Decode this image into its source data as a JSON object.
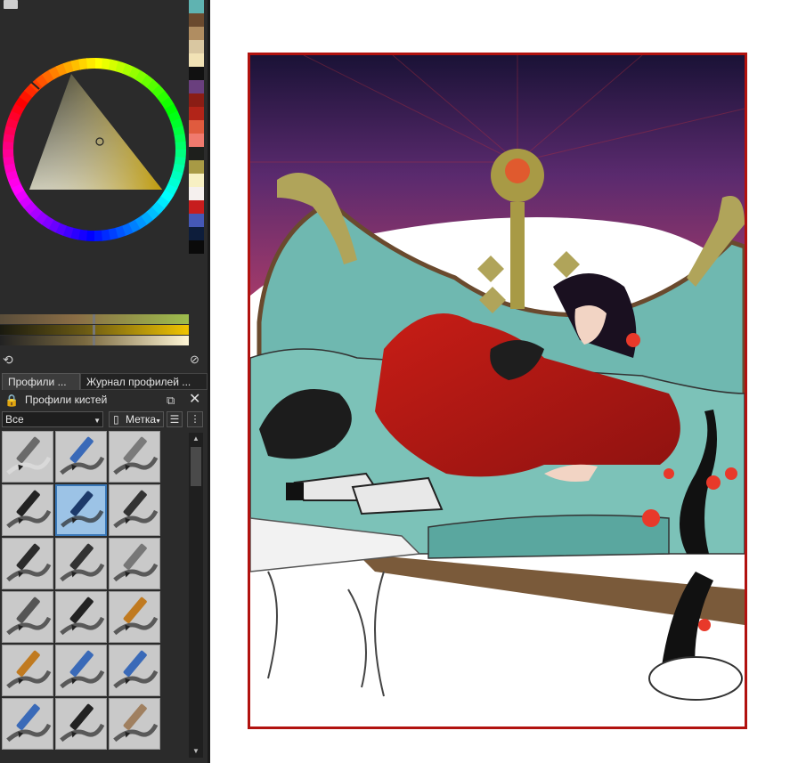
{
  "palette": {
    "swatches": [
      "#5fb3b1",
      "#6b4a2e",
      "#b08d61",
      "#d9c7a1",
      "#f1e2b5",
      "#111111",
      "#6a3f7e",
      "#8a1d14",
      "#b22418",
      "#e05b3e",
      "#f07a6e",
      "#1e1f1c",
      "#a89a45",
      "#f7f0c3",
      "#f5f0ee",
      "#c71d1d",
      "#4558b6",
      "#0d1d3b",
      "#0a0a0a"
    ]
  },
  "color_selector": {
    "hue": "#e0b400"
  },
  "tabs": [
    {
      "label": "Профили ..."
    },
    {
      "label": "Журнал профилей ..."
    }
  ],
  "brush_docker": {
    "title": "Профили кистей",
    "filter_value": "Все",
    "tag_label": "Метка"
  },
  "brushes": [
    {
      "name": "eraser-brush"
    },
    {
      "name": "eraser-pen-brush"
    },
    {
      "name": "blur-brush"
    },
    {
      "name": "airbrush-soft"
    },
    {
      "name": "ink-pen-selected"
    },
    {
      "name": "marker-pen"
    },
    {
      "name": "marker-pen-2"
    },
    {
      "name": "marker-pen-3"
    },
    {
      "name": "marker-pen-4"
    },
    {
      "name": "pencil-grey"
    },
    {
      "name": "fineliner"
    },
    {
      "name": "pencil-orange"
    },
    {
      "name": "pencil-orange-2"
    },
    {
      "name": "pencil-blue"
    },
    {
      "name": "pencil-blue-2"
    },
    {
      "name": "pencil-blue-3"
    },
    {
      "name": "pencil-dark"
    },
    {
      "name": "pencil-tan"
    }
  ]
}
